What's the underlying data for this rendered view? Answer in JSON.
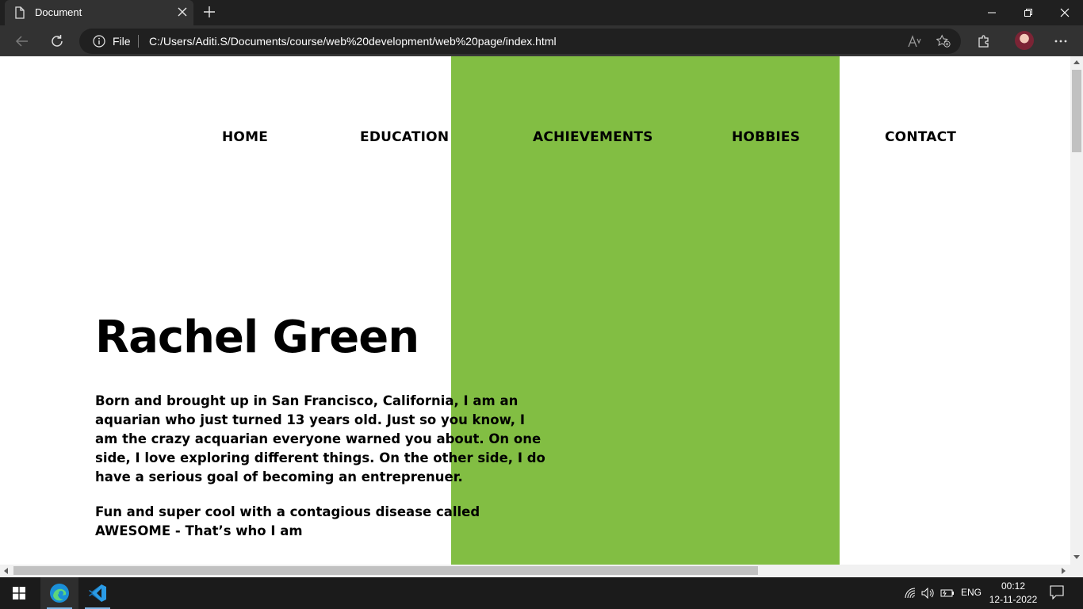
{
  "browser": {
    "tab_title": "Document",
    "address_scheme_label": "File",
    "url": "C:/Users/Aditi.S/Documents/course/web%20development/web%20page/index.html"
  },
  "page": {
    "accent_color": "#82be43",
    "nav": [
      "HOME",
      "EDUCATION",
      "ACHIEVEMENTS",
      "HOBBIES",
      "CONTACT"
    ],
    "name": "Rachel Green",
    "paragraphs": [
      "Born and brought up in San Francisco, California, I am an aquarian who just turned 13 years old. Just so you know, I am the crazy acquarian everyone warned you about. On one side, I love exploring different things. On the other side, I do have a serious goal of becoming an entreprenuer.",
      "Fun and super cool with a contagious disease called AWESOME - That’s who I am"
    ]
  },
  "taskbar": {
    "apps": [
      "edge-icon",
      "vscode-icon"
    ],
    "language": "ENG",
    "time": "00:12",
    "date": "12-11-2022"
  }
}
